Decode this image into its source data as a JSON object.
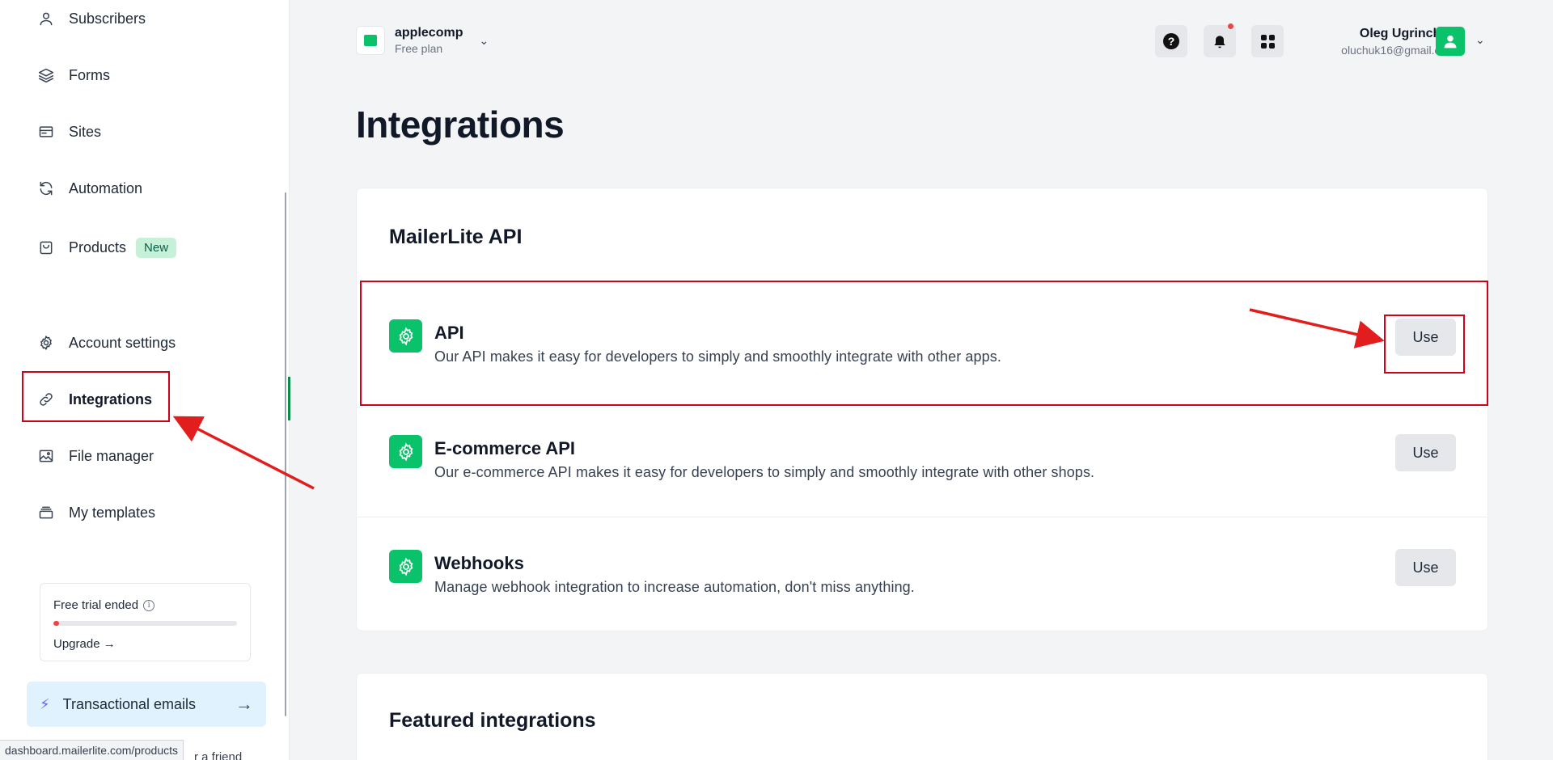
{
  "sidebar": {
    "items": [
      {
        "label": "Subscribers",
        "icon": "user-icon"
      },
      {
        "label": "Forms",
        "icon": "layers-icon"
      },
      {
        "label": "Sites",
        "icon": "browser-window-icon"
      },
      {
        "label": "Automation",
        "icon": "refresh-icon"
      },
      {
        "label": "Products",
        "icon": "shopping-bag-icon",
        "badge": "New"
      },
      {
        "label": "Account settings",
        "icon": "gear-icon"
      },
      {
        "label": "Integrations",
        "icon": "link-icon",
        "active": true
      },
      {
        "label": "File manager",
        "icon": "image-icon"
      },
      {
        "label": "My templates",
        "icon": "template-stack-icon"
      }
    ],
    "trial": {
      "title": "Free trial ended",
      "upgrade_label": "Upgrade →",
      "progress_percent": 3
    },
    "transactional": {
      "label": "Transactional emails"
    },
    "peek_text": "r a friend"
  },
  "status_bar": {
    "url": "dashboard.mailerlite.com/products"
  },
  "header": {
    "workspace": {
      "name": "applecomp",
      "plan": "Free plan"
    },
    "user": {
      "name": "Oleg Ugrinchuk",
      "email": "oluchuk16@gmail.com"
    }
  },
  "page": {
    "title": "Integrations",
    "api_section": {
      "title": "MailerLite API",
      "rows": [
        {
          "title": "API",
          "desc": "Our API makes it easy for developers to simply and smoothly integrate with other apps.",
          "button": "Use"
        },
        {
          "title": "E-commerce API",
          "desc": "Our e-commerce API makes it easy for developers to simply and smoothly integrate with other shops.",
          "button": "Use"
        },
        {
          "title": "Webhooks",
          "desc": "Manage webhook integration to increase automation, don't miss anything.",
          "button": "Use"
        }
      ]
    },
    "featured_section": {
      "title": "Featured integrations"
    }
  },
  "colors": {
    "brand_green": "#09c269",
    "annotation_red": "#d0021b"
  }
}
